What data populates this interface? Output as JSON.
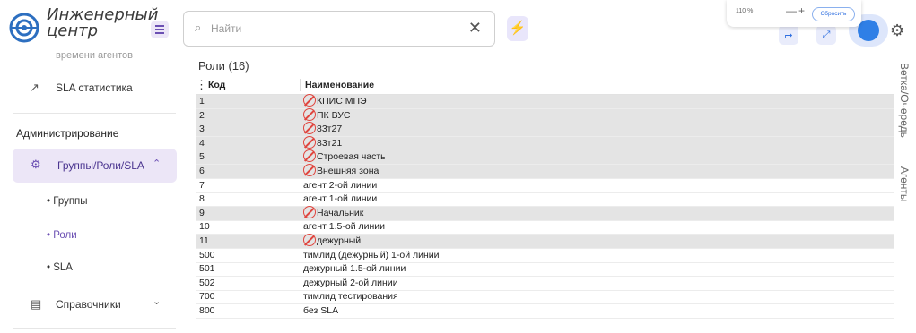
{
  "app": {
    "name_line1": "Инженерный",
    "name_line2": "центр"
  },
  "search": {
    "placeholder": "Найти"
  },
  "zoom": {
    "level": "110 %",
    "minus": "—",
    "plus": "+",
    "reset_label": "Сбросить"
  },
  "sidebar": {
    "cut_item": "времени агентов",
    "sla_stats": "SLA статистика",
    "admin_section": "Администрирование",
    "groups_roles_sla": "Группы/Роли/SLA",
    "sub_groups": "Группы",
    "sub_roles": "Роли",
    "sub_sla": "SLA",
    "directories": "Справочники"
  },
  "table": {
    "title": "Роли (16)",
    "col_code": "Код",
    "col_name": "Наименование",
    "rows": [
      {
        "code": "1",
        "name": "КПИС МПЭ",
        "blocked": true
      },
      {
        "code": "2",
        "name": "ПК ВУС",
        "blocked": true
      },
      {
        "code": "3",
        "name": "83т27",
        "blocked": true
      },
      {
        "code": "4",
        "name": "83т21",
        "blocked": true
      },
      {
        "code": "5",
        "name": "Строевая часть",
        "blocked": true
      },
      {
        "code": "6",
        "name": "Внешняя зона",
        "blocked": true
      },
      {
        "code": "7",
        "name": "агент 2-ой линии",
        "blocked": false
      },
      {
        "code": "8",
        "name": "агент 1-ой линии",
        "blocked": false
      },
      {
        "code": "9",
        "name": "Начальник",
        "blocked": true
      },
      {
        "code": "10",
        "name": "агент 1.5-ой линии",
        "blocked": false
      },
      {
        "code": "11",
        "name": "дежурный",
        "blocked": true
      },
      {
        "code": "500",
        "name": "тимлид (дежурный) 1-ой линии",
        "blocked": false
      },
      {
        "code": "501",
        "name": "дежурный 1.5-ой линии",
        "blocked": false
      },
      {
        "code": "502",
        "name": "дежурный 2-ой линии",
        "blocked": false
      },
      {
        "code": "700",
        "name": "тимлид тестирования",
        "blocked": false
      },
      {
        "code": "800",
        "name": "без SLA",
        "blocked": false
      }
    ]
  },
  "right_tabs": {
    "tab1": "Ветка/Очередь",
    "tab2": "Агенты"
  }
}
